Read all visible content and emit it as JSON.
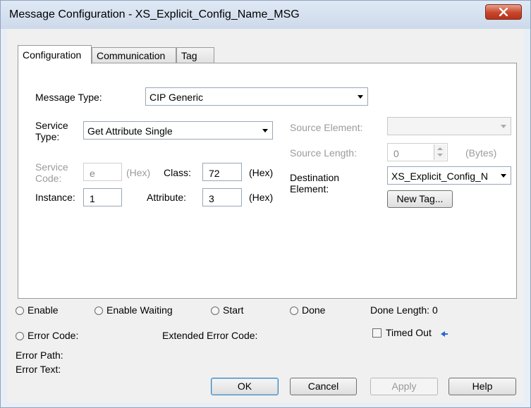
{
  "window": {
    "title": "Message Configuration - XS_Explicit_Config_Name_MSG"
  },
  "tabs": [
    {
      "label": "Configuration"
    },
    {
      "label": "Communication"
    },
    {
      "label": "Tag"
    }
  ],
  "config": {
    "message_type_label": "Message Type:",
    "message_type_value": "CIP Generic",
    "service_type_label_1": "Service",
    "service_type_label_2": "Type:",
    "service_type_value": "Get Attribute Single",
    "service_code_label_1": "Service",
    "service_code_label_2": "Code:",
    "service_code_value": "e",
    "service_code_unit": "(Hex)",
    "class_label": "Class:",
    "class_value": "72",
    "class_unit": "(Hex)",
    "instance_label": "Instance:",
    "instance_value": "1",
    "attribute_label": "Attribute:",
    "attribute_value": "3",
    "attribute_unit": "(Hex)",
    "source_element_label": "Source Element:",
    "source_element_value": "",
    "source_length_label": "Source Length:",
    "source_length_value": "0",
    "source_length_unit": "(Bytes)",
    "destination_label_1": "Destination",
    "destination_label_2": "Element:",
    "destination_value": "XS_Explicit_Config_N",
    "new_tag_label": "New Tag..."
  },
  "status": {
    "enable": "Enable",
    "enable_waiting": "Enable Waiting",
    "start": "Start",
    "done": "Done",
    "done_length": "Done Length: 0",
    "error_code": "Error Code:",
    "extended_error_code": "Extended Error Code:",
    "timed_out": "Timed Out",
    "error_path": "Error Path:",
    "error_text": "Error Text:"
  },
  "buttons": {
    "ok": "OK",
    "cancel": "Cancel",
    "apply": "Apply",
    "help": "Help"
  }
}
